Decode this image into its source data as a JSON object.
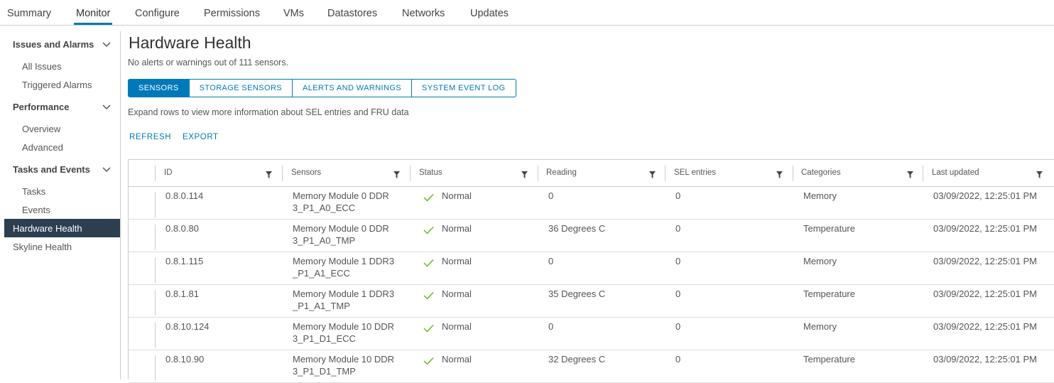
{
  "top_tabs": [
    "Summary",
    "Monitor",
    "Configure",
    "Permissions",
    "VMs",
    "Datastores",
    "Networks",
    "Updates"
  ],
  "active_tab": "Monitor",
  "sidebar": {
    "groups": [
      {
        "label": "Issues and Alarms",
        "items": [
          "All Issues",
          "Triggered Alarms"
        ]
      },
      {
        "label": "Performance",
        "items": [
          "Overview",
          "Advanced"
        ]
      },
      {
        "label": "Tasks and Events",
        "items": [
          "Tasks",
          "Events"
        ]
      }
    ],
    "selected": "Hardware Health",
    "extra": "Skyline Health"
  },
  "main": {
    "title": "Hardware Health",
    "subtitle": "No alerts or warnings out of 111 sensors.",
    "segments": [
      "SENSORS",
      "STORAGE SENSORS",
      "ALERTS AND WARNINGS",
      "SYSTEM EVENT LOG"
    ],
    "active_segment": "SENSORS",
    "hint": "Expand rows to view more information about SEL entries and FRU data",
    "actions": {
      "refresh": "REFRESH",
      "export": "EXPORT"
    }
  },
  "table": {
    "columns": [
      "ID",
      "Sensors",
      "Status",
      "Reading",
      "SEL entries",
      "Categories",
      "Last updated"
    ],
    "rows": [
      {
        "id": "0.8.0.114",
        "sensor_1": "Memory Module 0 DDR",
        "sensor_2": "3_P1_A0_ECC",
        "status": "Normal",
        "reading": "0",
        "sel": "0",
        "category": "Memory",
        "updated": "03/09/2022, 12:25:01 PM"
      },
      {
        "id": "0.8.0.80",
        "sensor_1": "Memory Module 0 DDR",
        "sensor_2": "3_P1_A0_TMP",
        "status": "Normal",
        "reading": "36 Degrees C",
        "sel": "0",
        "category": "Temperature",
        "updated": "03/09/2022, 12:25:01 PM"
      },
      {
        "id": "0.8.1.115",
        "sensor_1": "Memory Module 1 DDR3",
        "sensor_2": "_P1_A1_ECC",
        "status": "Normal",
        "reading": "0",
        "sel": "0",
        "category": "Memory",
        "updated": "03/09/2022, 12:25:01 PM"
      },
      {
        "id": "0.8.1.81",
        "sensor_1": "Memory Module 1 DDR3",
        "sensor_2": "_P1_A1_TMP",
        "status": "Normal",
        "reading": "35 Degrees C",
        "sel": "0",
        "category": "Temperature",
        "updated": "03/09/2022, 12:25:01 PM"
      },
      {
        "id": "0.8.10.124",
        "sensor_1": "Memory Module 10 DDR",
        "sensor_2": "3_P1_D1_ECC",
        "status": "Normal",
        "reading": "0",
        "sel": "0",
        "category": "Memory",
        "updated": "03/09/2022, 12:25:01 PM"
      },
      {
        "id": "0.8.10.90",
        "sensor_1": "Memory Module 10 DDR",
        "sensor_2": "3_P1_D1_TMP",
        "status": "Normal",
        "reading": "32 Degrees C",
        "sel": "0",
        "category": "Temperature",
        "updated": "03/09/2022, 12:25:01 PM"
      }
    ]
  },
  "colors": {
    "accent": "#0079b8",
    "selected_bg": "#2b3f51",
    "status_ok": "#5eb715"
  }
}
